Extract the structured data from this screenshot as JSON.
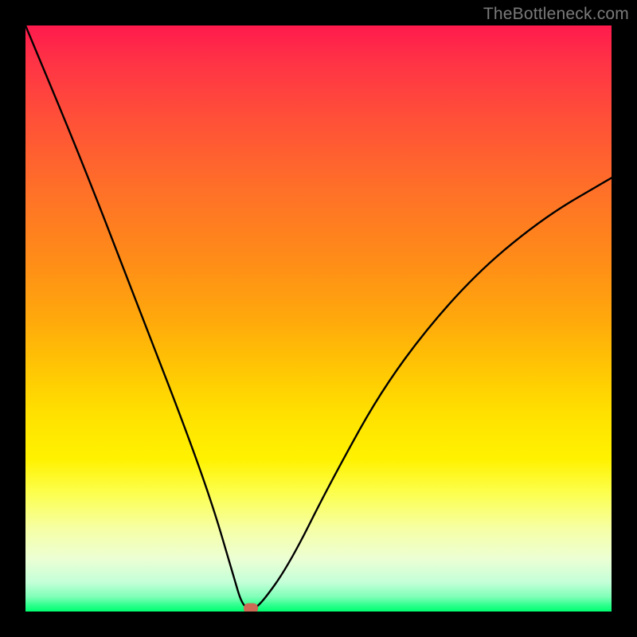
{
  "watermark": "TheBottleneck.com",
  "chart_data": {
    "type": "line",
    "title": "",
    "xlabel": "",
    "ylabel": "",
    "xlim": [
      0,
      100
    ],
    "ylim": [
      0,
      100
    ],
    "grid": false,
    "series": [
      {
        "name": "bottleneck-curve",
        "x": [
          0,
          10,
          20,
          27,
          32,
          35.5,
          37,
          38.5,
          40,
          45,
          52,
          62,
          75,
          88,
          100
        ],
        "values": [
          100,
          76,
          50,
          32,
          18,
          6,
          1,
          0.5,
          1,
          8,
          22,
          40,
          56,
          67,
          74
        ]
      }
    ],
    "marker": {
      "x": 38.5,
      "y": 0.5,
      "color": "#cc6a55"
    },
    "gradient": {
      "top": "#ff1a4d",
      "mid": "#ffe000",
      "bottom": "#00ff70"
    }
  }
}
